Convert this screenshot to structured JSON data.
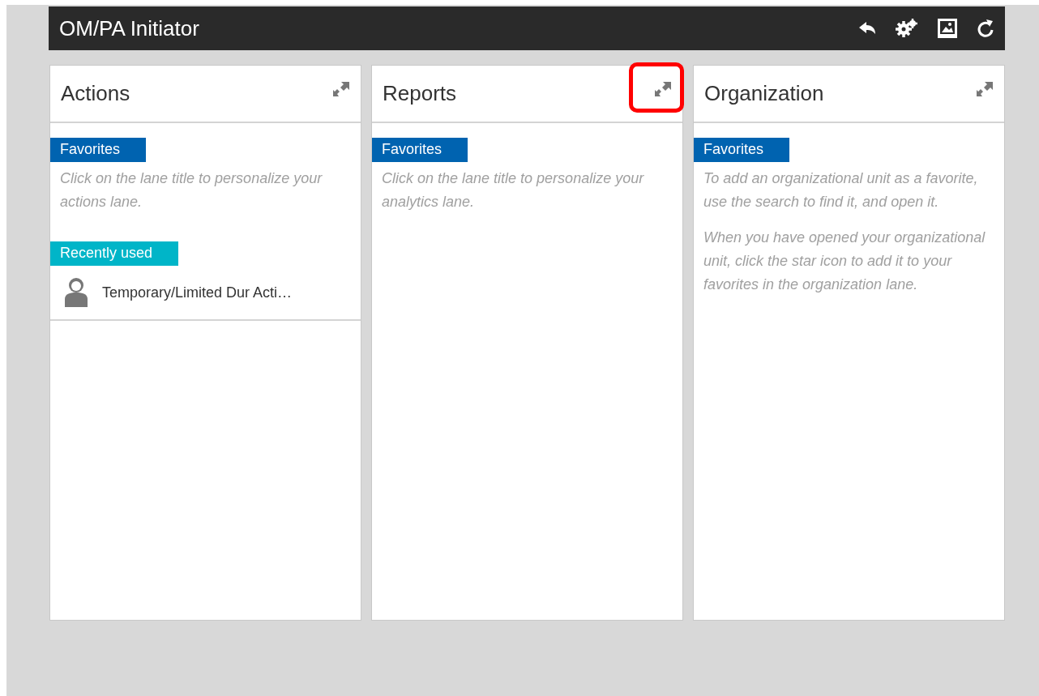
{
  "header": {
    "title": "OM/PA Initiator",
    "tools": [
      {
        "kind": "back"
      },
      {
        "kind": "settings"
      },
      {
        "kind": "picture"
      },
      {
        "kind": "refresh"
      }
    ]
  },
  "lanes": [
    {
      "title": "Actions",
      "highlighted": false,
      "sections": [
        {
          "tag": "Favorites",
          "color": "#0063b0",
          "notes": [
            "Click on the lane title to personalize your actions lane."
          ]
        },
        {
          "tag": "Recently used",
          "color": "#00b5c8",
          "items": [
            "Temporary/Limited Dur Acti…"
          ]
        }
      ]
    },
    {
      "title": "Reports",
      "highlighted": true,
      "sections": [
        {
          "tag": "Favorites",
          "color": "#0063b0",
          "notes": [
            "Click on the lane title to personalize your analytics lane."
          ]
        }
      ]
    },
    {
      "title": "Organization",
      "highlighted": false,
      "sections": [
        {
          "tag": "Favorites",
          "color": "#0063b0",
          "notes": [
            "To add an organizational unit as a favorite, use the search to find it, and open it.",
            "When you have opened your organizational unit, click the star icon to add it to your favorites in the organization lane."
          ]
        }
      ]
    }
  ]
}
